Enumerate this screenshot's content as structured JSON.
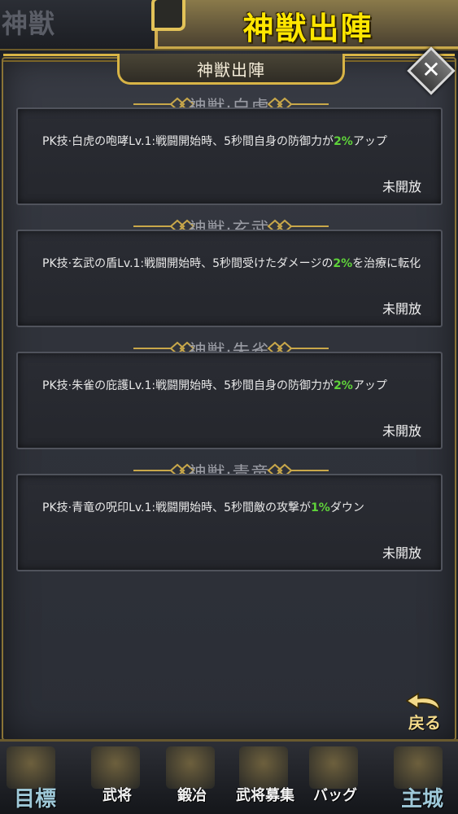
{
  "top": {
    "left_title": "神獣",
    "banner_title": "神獣出陣"
  },
  "dialog": {
    "title": "神獣出陣",
    "close_glyph": "✕",
    "sections": [
      {
        "title": "神獣·白虎",
        "desc_before": "PK技·白虎の咆哮Lv.1:戦闘開始時、5秒間自身の防御力が",
        "highlight": "2%",
        "desc_after": "アップ",
        "status": "未開放"
      },
      {
        "title": "神獣·玄武",
        "desc_before": "PK技·玄武の盾Lv.1:戦闘開始時、5秒間受けたダメージの",
        "highlight": "2%",
        "desc_after": "を治療に転化",
        "status": "未開放"
      },
      {
        "title": "神獣·朱雀",
        "desc_before": "PK技·朱雀の庇護Lv.1:戦闘開始時、5秒間自身の防御力が",
        "highlight": "2%",
        "desc_after": "アップ",
        "status": "未開放"
      },
      {
        "title": "神獣·青竜",
        "desc_before": "PK技·青竜の呪印Lv.1:戦闘開始時、5秒間敵の攻撃が",
        "highlight": "1%",
        "desc_after": "ダウン",
        "status": "未開放"
      }
    ],
    "back_label": "戻る"
  },
  "nav": {
    "items": [
      {
        "label": "目標"
      },
      {
        "label": "武将"
      },
      {
        "label": "鍛冶"
      },
      {
        "label": "武将募集"
      },
      {
        "label": "バッグ"
      },
      {
        "label": "主城"
      }
    ]
  },
  "colors": {
    "accent_gold": "#d8b446",
    "highlight_green": "#5fd33a",
    "banner_yellow": "#ffe600"
  }
}
